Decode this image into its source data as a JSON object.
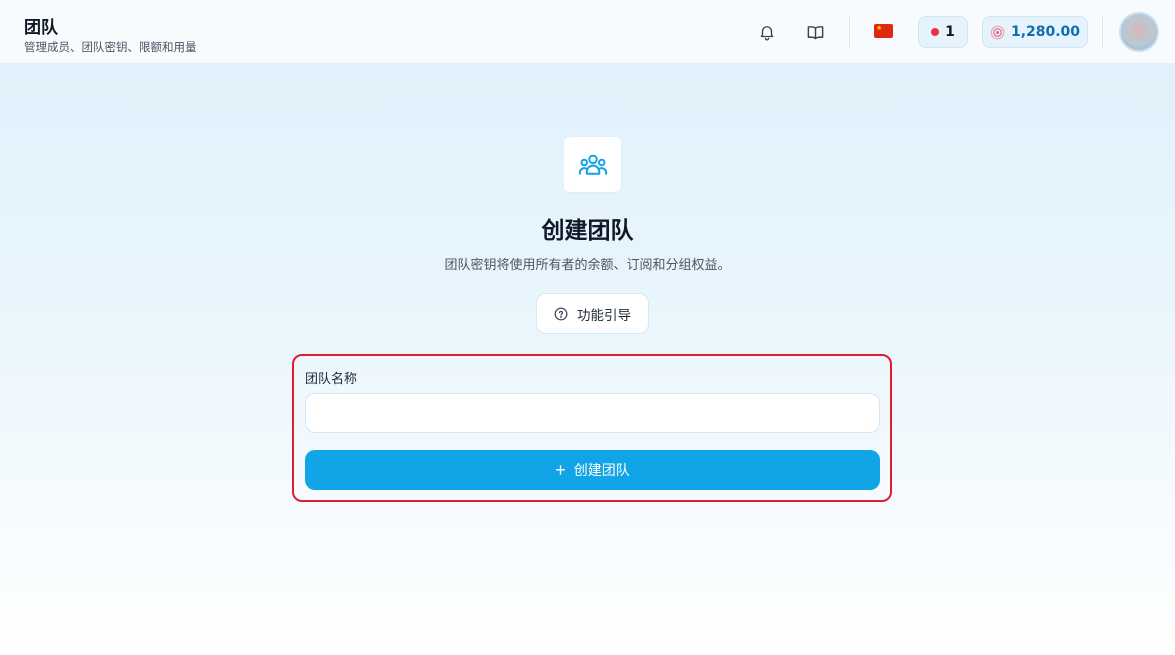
{
  "header": {
    "title": "团队",
    "subtitle": "管理成员、团队密钥、限额和用量",
    "alert_count": "1",
    "balance": "1,280.00"
  },
  "hero": {
    "title": "创建团队",
    "description": "团队密钥将使用所有者的余额、订阅和分组权益。",
    "guide_button": "功能引导"
  },
  "form": {
    "name_label": "团队名称",
    "name_value": "",
    "name_placeholder": "",
    "create_button": "创建团队"
  },
  "colors": {
    "primary": "#11a5e8",
    "highlight_border": "#e21b2d",
    "alert_dot": "#ef2f3c",
    "balance_text": "#0b6fb0"
  },
  "icons": [
    "bell-icon",
    "book-icon",
    "china-flag-icon",
    "coin-icon",
    "users-icon",
    "help-circle-icon",
    "plus-icon"
  ]
}
